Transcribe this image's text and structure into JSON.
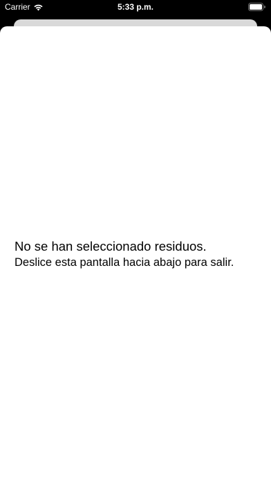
{
  "status_bar": {
    "carrier": "Carrier",
    "time": "5:33 p.m.",
    "wifi_icon": "wifi-icon",
    "battery_icon": "battery-icon"
  },
  "sheet": {
    "message_line1": "No se han seleccionado residuos.",
    "message_line2": "Deslice esta pantalla hacia abajo para salir."
  },
  "colors": {
    "background": "#000000",
    "sheet": "#ffffff",
    "sheet_behind": "#d9d9d9",
    "text": "#000000"
  }
}
